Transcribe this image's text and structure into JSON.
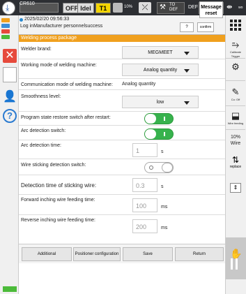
{
  "topbar": {
    "robot_name": "CR610",
    "off": "OFF",
    "idel": "Idel",
    "mode": "T1",
    "speed": "10%",
    "tool_line1": "TO",
    "tool_line2": "DEF",
    "def": "DEF",
    "io": "DO",
    "jog": "wo"
  },
  "message": {
    "time": "2025/02/20 09:56:33",
    "text": "Log inManufacturer personnelsuccess",
    "q_label": "?",
    "confirm_label": "confirm",
    "reset_label": "Message reset"
  },
  "panel": {
    "title": "Welding process package",
    "rows": {
      "welder_brand": {
        "label": "Welder brand:",
        "value": "MEGMEET"
      },
      "working_mode": {
        "label": "Working mode of welding machine:",
        "value": "Analog quantity"
      },
      "comm_mode": {
        "label": "Communication mode of welding machine:",
        "value": "Analog quantity"
      },
      "smoothness": {
        "label": "Smoothness level:",
        "value": "low"
      },
      "restore_switch": {
        "label": "Program state restore switch after restart:"
      },
      "arc_switch": {
        "label": "Arc detection switch:"
      },
      "arc_time": {
        "label": "Arc detection time:",
        "value": "1",
        "unit": "s"
      },
      "wire_switch": {
        "label": "Wire sticking detection switch:"
      },
      "wire_time": {
        "label": "Detection time of sticking wire:",
        "value": "0.3",
        "unit": "s"
      },
      "fwd_time": {
        "label": "Forward inching wire feeding time:",
        "value": "100",
        "unit": "ms"
      },
      "rev_time": {
        "label": "Reverse inching wire feeding time:",
        "value": "200",
        "unit": "ms"
      }
    },
    "buttons": {
      "additional": "Additional",
      "positioner": "Positioner configuration",
      "save": "Save",
      "return": "Return"
    }
  },
  "rightbar": {
    "calibration": "Calibrate Trigger",
    "coords": "",
    "coord_off": "Co: Off",
    "wire_feed": "Wire feeding",
    "pct": "10%",
    "pct_label": "Wire",
    "replace": "replace"
  },
  "colors": {
    "accent": "#f0a01e",
    "toggle_on": "#37b24d",
    "mode_yellow": "#f3d400",
    "error_red": "#e64a3c"
  }
}
